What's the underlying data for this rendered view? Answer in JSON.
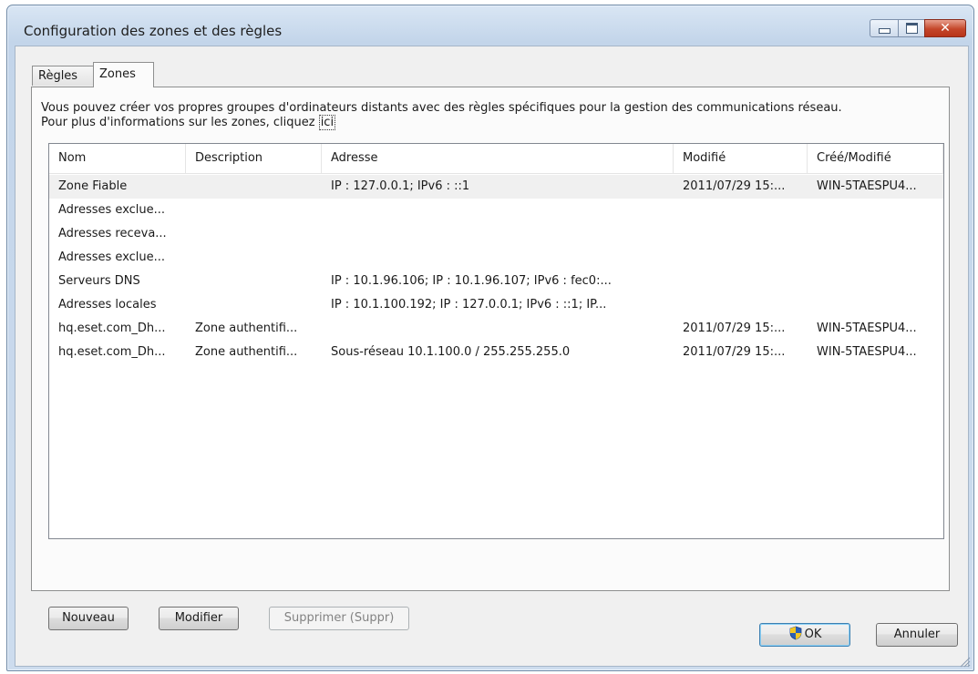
{
  "window": {
    "title": "Configuration des zones et des règles",
    "close_symbol": "✕"
  },
  "tabs": [
    {
      "label": "Règles"
    },
    {
      "label": "Zones"
    }
  ],
  "intro": {
    "line1": "Vous pouvez créer vos propres groupes d'ordinateurs distants avec des règles spécifiques pour la gestion des communications réseau.",
    "line2": "Pour plus d'informations sur les zones, cliquez ",
    "link": "ici"
  },
  "table": {
    "columns": [
      "Nom",
      "Description",
      "Adresse",
      "Modifié",
      "Créé/Modifié"
    ],
    "rows": [
      [
        "Zone Fiable",
        "",
        "IP : 127.0.0.1; IPv6 : ::1",
        "2011/07/29 15:...",
        "WIN-5TAESPU4..."
      ],
      [
        "Adresses exclue...",
        "",
        "",
        "",
        ""
      ],
      [
        "Adresses receva...",
        "",
        "",
        "",
        ""
      ],
      [
        "Adresses exclue...",
        "",
        "",
        "",
        ""
      ],
      [
        "Serveurs DNS",
        "",
        "IP : 10.1.96.106; IP : 10.1.96.107; IPv6 : fec0:...",
        "",
        ""
      ],
      [
        "Adresses locales",
        "",
        "IP : 10.1.100.192; IP : 127.0.0.1; IPv6 : ::1; IP...",
        "",
        ""
      ],
      [
        "hq.eset.com_Dh...",
        "Zone authentifi...",
        "",
        "2011/07/29 15:...",
        "WIN-5TAESPU4..."
      ],
      [
        "hq.eset.com_Dh...",
        "Zone authentifi...",
        "Sous-réseau 10.1.100.0 / 255.255.255.0",
        "2011/07/29 15:...",
        "WIN-5TAESPU4..."
      ]
    ]
  },
  "buttons": {
    "new": "Nouveau",
    "edit": "Modifier",
    "delete": "Supprimer (Suppr)",
    "ok": "OK",
    "cancel": "Annuler"
  },
  "icons": {
    "ok_shield": "uac-shield-icon",
    "minimize": "minimize-icon",
    "maximize": "maximize-icon",
    "close": "close-icon"
  },
  "colors": {
    "close_button": "#c4462a",
    "selected_row": "#f0f0f0"
  }
}
